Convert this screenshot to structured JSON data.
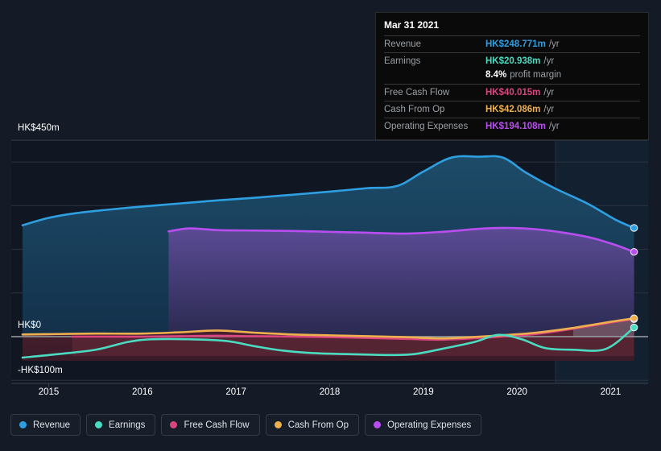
{
  "chart_data": {
    "type": "area",
    "title": "",
    "xlabel": "",
    "ylabel": "",
    "currency": "HK$",
    "units": "m",
    "grid": true,
    "legend_position": "bottom",
    "xlim": [
      2014.6,
      2021.4
    ],
    "ylim": [
      -100,
      450
    ],
    "y_ticks": [
      {
        "value": 450,
        "label": "HK$450m"
      },
      {
        "value": 0,
        "label": "HK$0"
      },
      {
        "value": -100,
        "label": "-HK$100m"
      }
    ],
    "x_ticks": [
      {
        "value": 2015,
        "label": "2015"
      },
      {
        "value": 2016,
        "label": "2016"
      },
      {
        "value": 2017,
        "label": "2017"
      },
      {
        "value": 2018,
        "label": "2018"
      },
      {
        "value": 2019,
        "label": "2019"
      },
      {
        "value": 2020,
        "label": "2020"
      },
      {
        "value": 2021,
        "label": "2021"
      }
    ],
    "forecast_boundary_x": 2020.35,
    "series": [
      {
        "name": "Revenue",
        "color": "#2e9fe0",
        "x": [
          2014.72,
          2015.0,
          2015.3,
          2015.6,
          2016.0,
          2016.4,
          2016.8,
          2017.2,
          2017.6,
          2018.0,
          2018.4,
          2018.72,
          2019.0,
          2019.3,
          2019.6,
          2019.85,
          2020.1,
          2020.4,
          2020.75,
          2021.05,
          2021.25
        ],
        "values": [
          255,
          272,
          283,
          290,
          298,
          305,
          312,
          318,
          325,
          332,
          340,
          345,
          378,
          410,
          412,
          410,
          375,
          340,
          305,
          268,
          249
        ]
      },
      {
        "name": "Operating Expenses",
        "color": "#b94ef0",
        "x": [
          2016.28,
          2016.5,
          2016.8,
          2017.2,
          2017.6,
          2018.0,
          2018.4,
          2018.8,
          2019.2,
          2019.6,
          2019.9,
          2020.2,
          2020.5,
          2020.8,
          2021.05,
          2021.25
        ],
        "values": [
          241,
          248,
          244,
          243,
          242,
          240,
          238,
          236,
          240,
          247,
          249,
          246,
          238,
          226,
          210,
          194
        ]
      },
      {
        "name": "Cash From Op",
        "color": "#eeb04e",
        "x": [
          2014.72,
          2015.1,
          2015.5,
          2016.0,
          2016.4,
          2016.8,
          2017.2,
          2017.6,
          2018.0,
          2018.4,
          2018.8,
          2019.2,
          2019.6,
          2019.9,
          2020.2,
          2020.6,
          2021.0,
          2021.25
        ],
        "values": [
          5,
          6,
          7,
          7,
          10,
          14,
          9,
          5,
          3,
          1,
          -1,
          -4,
          0,
          4,
          9,
          20,
          34,
          42
        ]
      },
      {
        "name": "Free Cash Flow",
        "color": "#d9457f",
        "x": [
          2015.25,
          2015.6,
          2016.0,
          2016.4,
          2016.8,
          2017.2,
          2017.6,
          2018.0,
          2018.4,
          2018.8,
          2019.2,
          2019.6,
          2019.9,
          2020.2,
          2020.6,
          2021.0,
          2021.25
        ],
        "values": [
          0,
          0,
          0,
          1,
          2,
          1,
          0,
          -1,
          -3,
          -5,
          -7,
          -3,
          1,
          6,
          18,
          32,
          40
        ]
      },
      {
        "name": "Earnings",
        "color": "#4adbc0",
        "x": [
          2014.72,
          2015.1,
          2015.5,
          2015.85,
          2016.1,
          2016.5,
          2016.9,
          2017.2,
          2017.5,
          2017.85,
          2018.2,
          2018.6,
          2018.9,
          2019.2,
          2019.55,
          2019.8,
          2020.05,
          2020.3,
          2020.6,
          2020.95,
          2021.25
        ],
        "values": [
          -48,
          -40,
          -30,
          -12,
          -6,
          -6,
          -10,
          -22,
          -32,
          -38,
          -40,
          -42,
          -40,
          -28,
          -12,
          4,
          -6,
          -26,
          -30,
          -28,
          21
        ]
      }
    ]
  },
  "tooltip": {
    "date": "Mar 31 2021",
    "rows": [
      {
        "label": "Revenue",
        "value": "HK$248.771m",
        "unit": "/yr",
        "color": "#2e9fe0"
      },
      {
        "label": "Earnings",
        "value": "HK$20.938m",
        "unit": "/yr",
        "color": "#4adbc0"
      },
      {
        "label": "",
        "value": "8.4%",
        "unit": "profit margin",
        "color": "#ffffff"
      },
      {
        "label": "Free Cash Flow",
        "value": "HK$40.015m",
        "unit": "/yr",
        "color": "#d9457f"
      },
      {
        "label": "Cash From Op",
        "value": "HK$42.086m",
        "unit": "/yr",
        "color": "#eeb04e"
      },
      {
        "label": "Operating Expenses",
        "value": "HK$194.108m",
        "unit": "/yr",
        "color": "#b94ef0"
      }
    ]
  },
  "legend": {
    "items": [
      {
        "label": "Revenue",
        "color": "#2e9fe0"
      },
      {
        "label": "Earnings",
        "color": "#4adbc0"
      },
      {
        "label": "Free Cash Flow",
        "color": "#d9457f"
      },
      {
        "label": "Cash From Op",
        "color": "#eeb04e"
      },
      {
        "label": "Operating Expenses",
        "color": "#b94ef0"
      }
    ]
  },
  "colors": {
    "background": "#151b26",
    "plot_background": "#111722",
    "forecast_background": "#131d2e",
    "gridline": "#2b3340",
    "zero_line": "#9aa0a6",
    "axis_text": "#ffffff"
  }
}
